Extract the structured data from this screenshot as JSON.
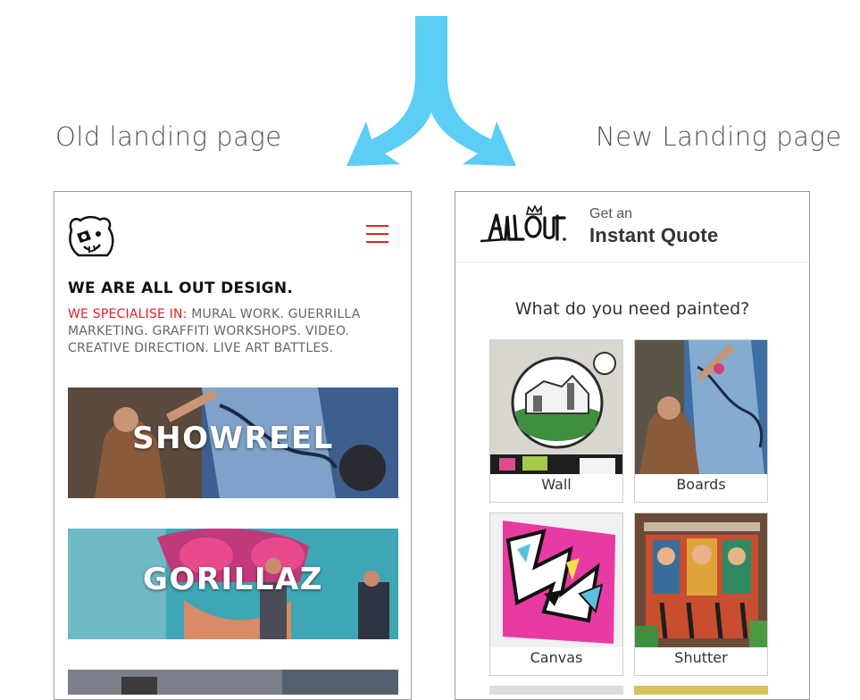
{
  "captions": {
    "left": "Old landing page",
    "right": "New Landing page"
  },
  "colors": {
    "arrow": "#5ccdf4",
    "accent_red": "#e21d23",
    "text_dark": "#111111",
    "text_grey": "#666666"
  },
  "old_page": {
    "heading": "WE ARE ALL OUT DESIGN.",
    "specialise_label": "WE SPECIALISE IN:",
    "specialise_text": " MURAL WORK. GUERRILLA MARKETING. GRAFFITI WORKSHOPS. VIDEO. CREATIVE DIRECTION. LIVE ART BATTLES.",
    "tiles": [
      {
        "title": "SHOWREEL"
      },
      {
        "title": "GORILLAZ"
      }
    ]
  },
  "new_page": {
    "header": {
      "pre": "Get an",
      "title": "Instant Quote"
    },
    "question": "What do you need painted?",
    "options": [
      {
        "label": "Wall"
      },
      {
        "label": "Boards"
      },
      {
        "label": "Canvas"
      },
      {
        "label": "Shutter"
      }
    ]
  }
}
